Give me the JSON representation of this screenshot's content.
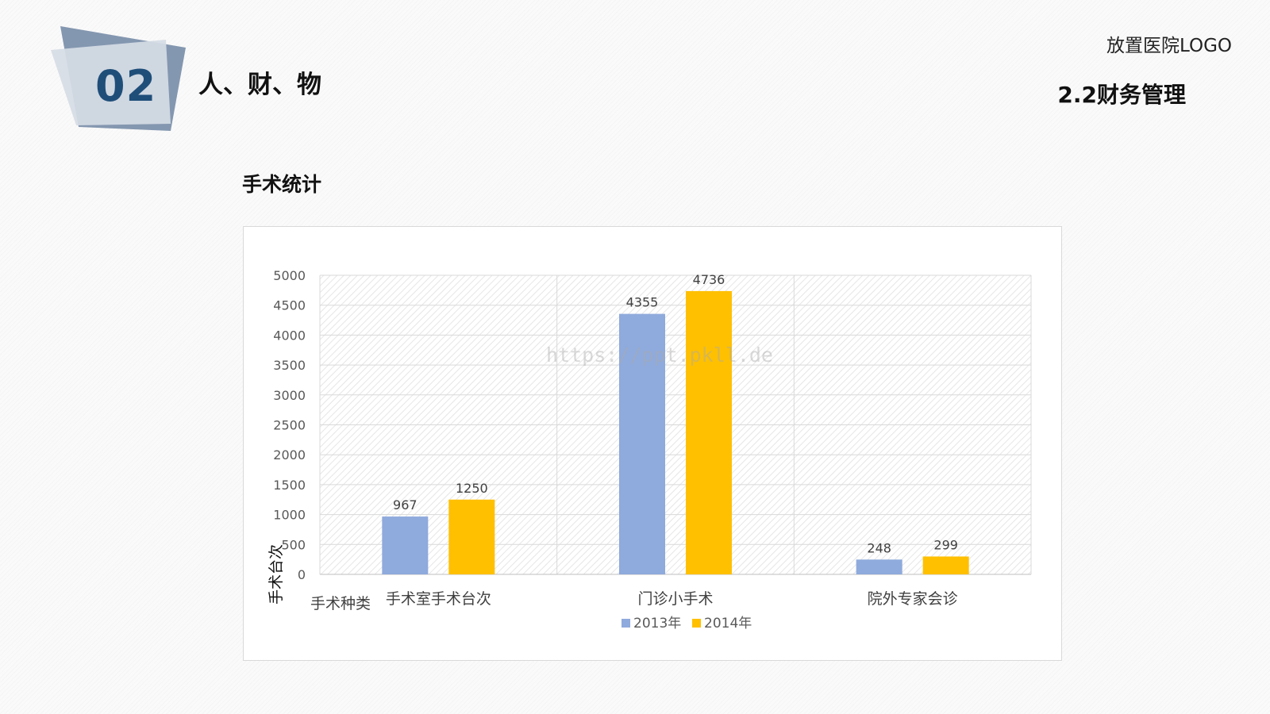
{
  "header": {
    "section_number": "02",
    "section_title": "人、财、物",
    "logo_text": "放置医院LOGO",
    "subsection_title": "2.2财务管理"
  },
  "chart_heading": "手术统计",
  "watermark": "https://ppt.pkll.de",
  "colors": {
    "series_2013": "#8faadc",
    "series_2014": "#ffc000",
    "badge_dark": "#8497b0",
    "badge_light": "#d6dce5",
    "badge_text": "#1f4e79"
  },
  "chart_data": {
    "type": "bar",
    "categories": [
      "手术室手术台次",
      "门诊小手术",
      "院外专家会诊"
    ],
    "series": [
      {
        "name": "2013年",
        "values": [
          967,
          4355,
          248
        ]
      },
      {
        "name": "2014年",
        "values": [
          1250,
          4736,
          299
        ]
      }
    ],
    "ylabel": "手术台次",
    "xlabel": "手术种类",
    "ylim": [
      0,
      5000
    ],
    "yticks": [
      0,
      500,
      1000,
      1500,
      2000,
      2500,
      3000,
      3500,
      4000,
      4500,
      5000
    ],
    "data_labels": true,
    "grid": true,
    "legend_position": "bottom"
  }
}
